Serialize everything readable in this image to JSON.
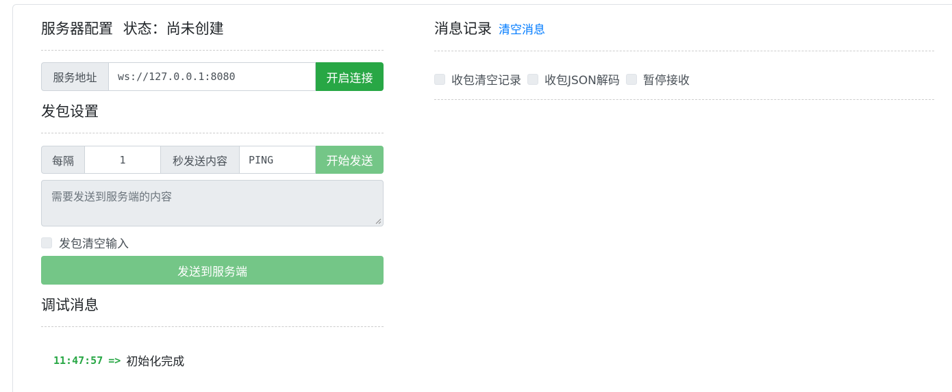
{
  "server": {
    "title": "服务器配置",
    "status_label": "状态：",
    "status_value": "尚未创建",
    "address_label": "服务地址",
    "address_value": "ws://127.0.0.1:8080",
    "connect_button": "开启连接"
  },
  "send": {
    "title": "发包设置",
    "every_label": "每隔",
    "interval_value": "1",
    "content_label": "秒发送内容",
    "content_value": "PING",
    "start_button": "开始发送",
    "textarea_placeholder": "需要发送到服务端的内容",
    "clear_input_label": "发包清空输入",
    "send_button": "发送到服务端"
  },
  "debug": {
    "title": "调试消息",
    "logs": [
      {
        "time": "11:47:57",
        "arrow": "=>",
        "text": "初始化完成"
      }
    ]
  },
  "messages": {
    "title": "消息记录",
    "clear_link": "清空消息",
    "options": [
      {
        "label": "收包清空记录",
        "checked": false
      },
      {
        "label": "收包JSON解码",
        "checked": false
      },
      {
        "label": "暂停接收",
        "checked": false
      }
    ]
  },
  "colors": {
    "success": "#28a745",
    "success_light": "#74c687",
    "link": "#007bff",
    "input_bg": "#e9ecef"
  }
}
